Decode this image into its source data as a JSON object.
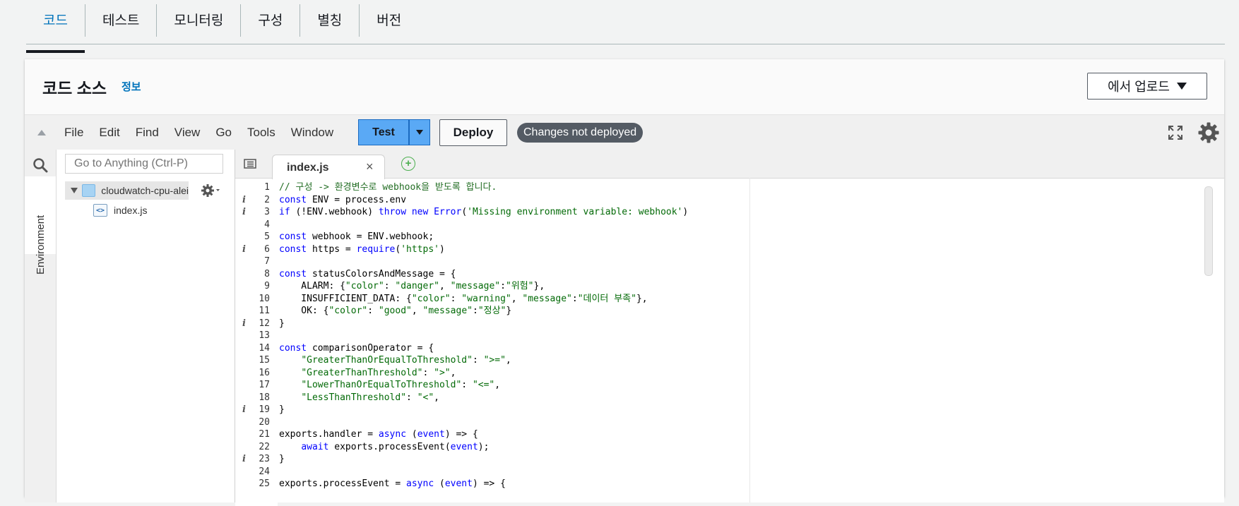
{
  "tabs": [
    "코드",
    "테스트",
    "모니터링",
    "구성",
    "별칭",
    "버전"
  ],
  "panel": {
    "title": "코드 소스",
    "info": "정보",
    "upload": "에서 업로드"
  },
  "ide": {
    "menu": [
      "File",
      "Edit",
      "Find",
      "View",
      "Go",
      "Tools",
      "Window"
    ],
    "test": "Test",
    "deploy": "Deploy",
    "status": "Changes not deployed",
    "accent": "#5aa9f5"
  },
  "sidebar": {
    "env_label": "Environment",
    "search_placeholder": "Go to Anything (Ctrl-P)",
    "folder": "cloudwatch-cpu-alei",
    "file": "index.js"
  },
  "editor": {
    "tab": "index.js",
    "info_lines": [
      2,
      3,
      6,
      12,
      19,
      23
    ],
    "lines": [
      "// 구성 -> 환경변수로 webhook을 받도록 합니다.",
      "const ENV = process.env",
      "if (!ENV.webhook) throw new Error('Missing environment variable: webhook')",
      "",
      "const webhook = ENV.webhook;",
      "const https = require('https')",
      "",
      "const statusColorsAndMessage = {",
      "    ALARM: {\"color\": \"danger\", \"message\":\"위험\"},",
      "    INSUFFICIENT_DATA: {\"color\": \"warning\", \"message\":\"데이터 부족\"},",
      "    OK: {\"color\": \"good\", \"message\":\"정상\"}",
      "}",
      "",
      "const comparisonOperator = {",
      "    \"GreaterThanOrEqualToThreshold\": \">=\",",
      "    \"GreaterThanThreshold\": \">\",",
      "    \"LowerThanOrEqualToThreshold\": \"<=\",",
      "    \"LessThanThreshold\": \"<\",",
      "}",
      "",
      "exports.handler = async (event) => {",
      "    await exports.processEvent(event);",
      "}",
      "",
      "exports.processEvent = async (event) => {"
    ]
  }
}
